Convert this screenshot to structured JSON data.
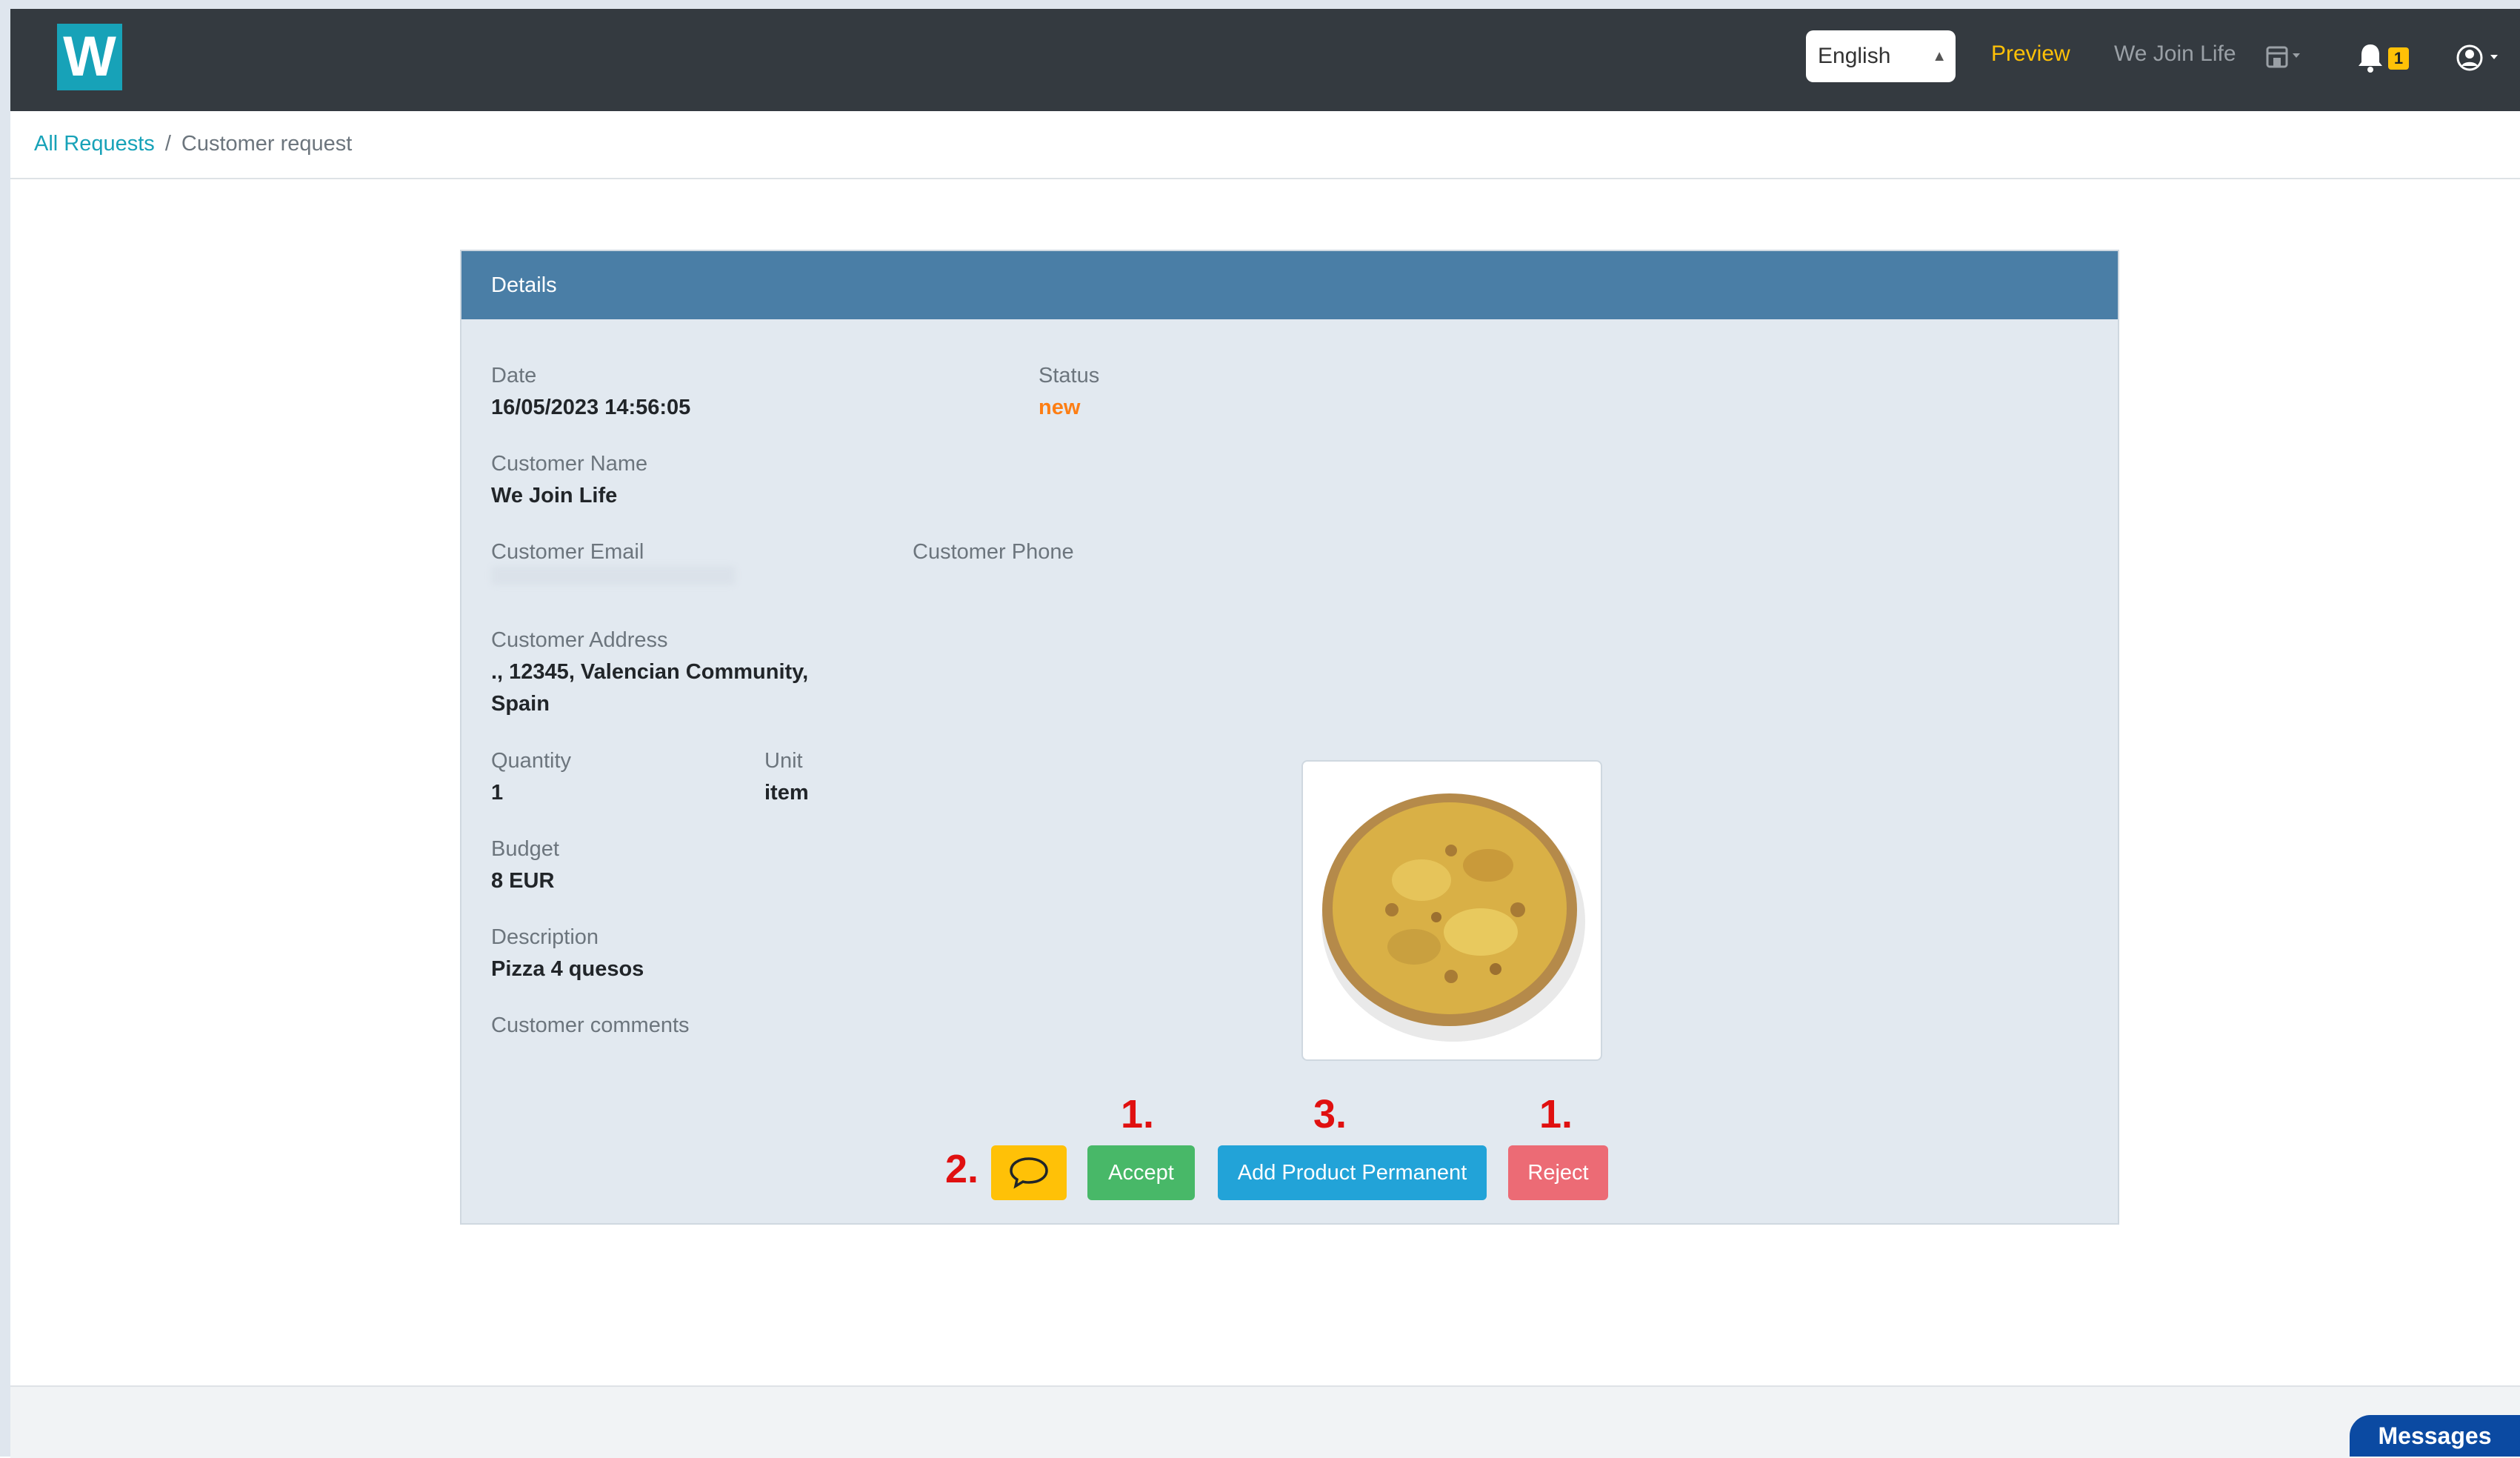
{
  "navbar": {
    "logo_letter": "W",
    "language_select": {
      "value": "English"
    },
    "preview_label": "Preview",
    "store_name": "We Join Life",
    "notification_count": "1"
  },
  "breadcrumb": {
    "root_label": "All Requests",
    "current_label": "Customer request"
  },
  "details": {
    "header": "Details",
    "date_label": "Date",
    "date_value": "16/05/2023 14:56:05",
    "status_label": "Status",
    "status_value": "new",
    "customer_name_label": "Customer Name",
    "customer_name_value": "We Join Life",
    "customer_email_label": "Customer Email",
    "customer_phone_label": "Customer Phone",
    "customer_address_label": "Customer Address",
    "customer_address_line1": "., 12345, Valencian Community,",
    "customer_address_line2": "Spain",
    "quantity_label": "Quantity",
    "quantity_value": "1",
    "unit_label": "Unit",
    "unit_value": "item",
    "budget_label": "Budget",
    "budget_value": "8 EUR",
    "description_label": "Description",
    "description_value": "Pizza 4 quesos",
    "customer_comments_label": "Customer comments"
  },
  "actions": {
    "accept_label": "Accept",
    "add_product_label": "Add Product Permanent",
    "reject_label": "Reject"
  },
  "annotations": {
    "comment": "2.",
    "accept": "1.",
    "add_product": "3.",
    "reject": "1."
  },
  "footer": {
    "messages_label": "Messages"
  },
  "colors": {
    "navbar_bg": "#343a40",
    "logo": "#17a2b8",
    "preview": "#ffc107",
    "card_header": "#4a7ea6",
    "status_new": "#fd7e14",
    "accept": "#48b868",
    "add_product": "#22a3d8",
    "reject": "#ec6b75",
    "comment": "#ffc107",
    "messages": "#0b4aa2"
  }
}
